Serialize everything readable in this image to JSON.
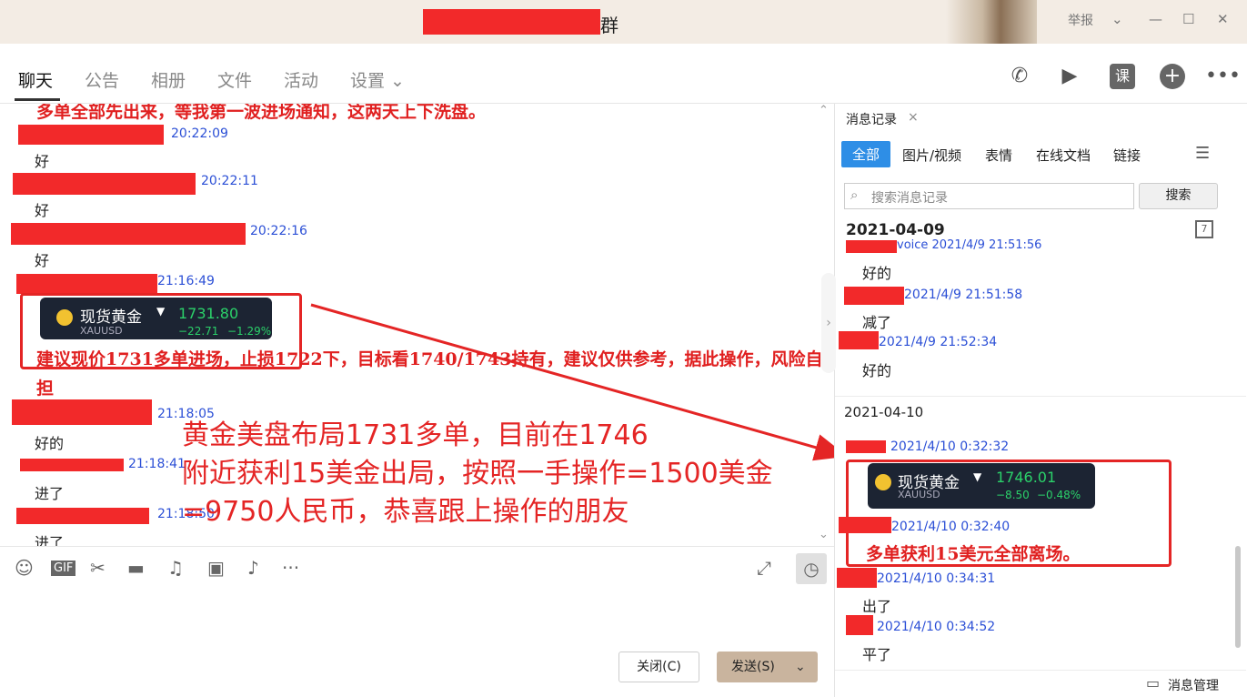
{
  "window": {
    "title_suffix": "群",
    "report": "举报",
    "minimize": "—",
    "maximize": "☐",
    "close": "✕"
  },
  "tabs": [
    "聊天",
    "公告",
    "相册",
    "文件",
    "活动",
    "设置 ⌄"
  ],
  "chat": {
    "top_line": "多单全部先出来，等我第一波进场通知，这两天上下洗盘。",
    "messages": [
      {
        "time": "20:22:09",
        "text": "好"
      },
      {
        "time": "20:22:11",
        "text": "好"
      },
      {
        "time": "20:22:16",
        "text": "好"
      },
      {
        "time": "21:16:49",
        "text": ""
      },
      {
        "time": "21:18:05",
        "text": "好的"
      },
      {
        "time": "21:18:41",
        "text": "进了"
      },
      {
        "time": "21:18:50",
        "text": "进了"
      }
    ],
    "card1": {
      "name": "现货黄金",
      "symbol": "XAUUSD",
      "price": "1731.80",
      "change": "−22.71",
      "pct": "−1.29%"
    },
    "advice": "建议现价1731多单进场，止损1722下，目标看1740/1743持有，建议仅供参考，据此操作，风险自担",
    "overlay": [
      "黄金美盘布局1731多单，目前在1746",
      "附近获利15美金出局，按照一手操作=1500美金",
      "=9750人民币，恭喜跟上操作的朋友"
    ]
  },
  "toolbar": {
    "close_btn": "关闭(C)",
    "send_btn": "发送(S)"
  },
  "history": {
    "tab_label": "消息记录",
    "filters": [
      "全部",
      "图片/视频",
      "表情",
      "在线文档",
      "链接"
    ],
    "search_placeholder": "搜索消息记录",
    "search_btn": "搜索",
    "date1": "2021-04-09",
    "items1": [
      {
        "time": "voice 2021/4/9 21:51:56",
        "text": "好的"
      },
      {
        "time": "2021/4/9 21:51:58",
        "text": "减了"
      },
      {
        "time": "2021/4/9 21:52:34",
        "text": "好的"
      }
    ],
    "date2": "2021-04-10",
    "time_a": "2021/4/10 0:32:32",
    "card2": {
      "name": "现货黄金",
      "symbol": "XAUUSD",
      "price": "1746.01",
      "change": "−8.50",
      "pct": "−0.48%"
    },
    "time_b": "2021/4/10 0:32:40",
    "profit": "多单获利15美元全部离场。",
    "items2": [
      {
        "time": "2021/4/10 0:34:31",
        "text": "出了"
      },
      {
        "time": "2021/4/10 0:34:52",
        "text": "平了"
      }
    ],
    "manage": "消息管理"
  }
}
